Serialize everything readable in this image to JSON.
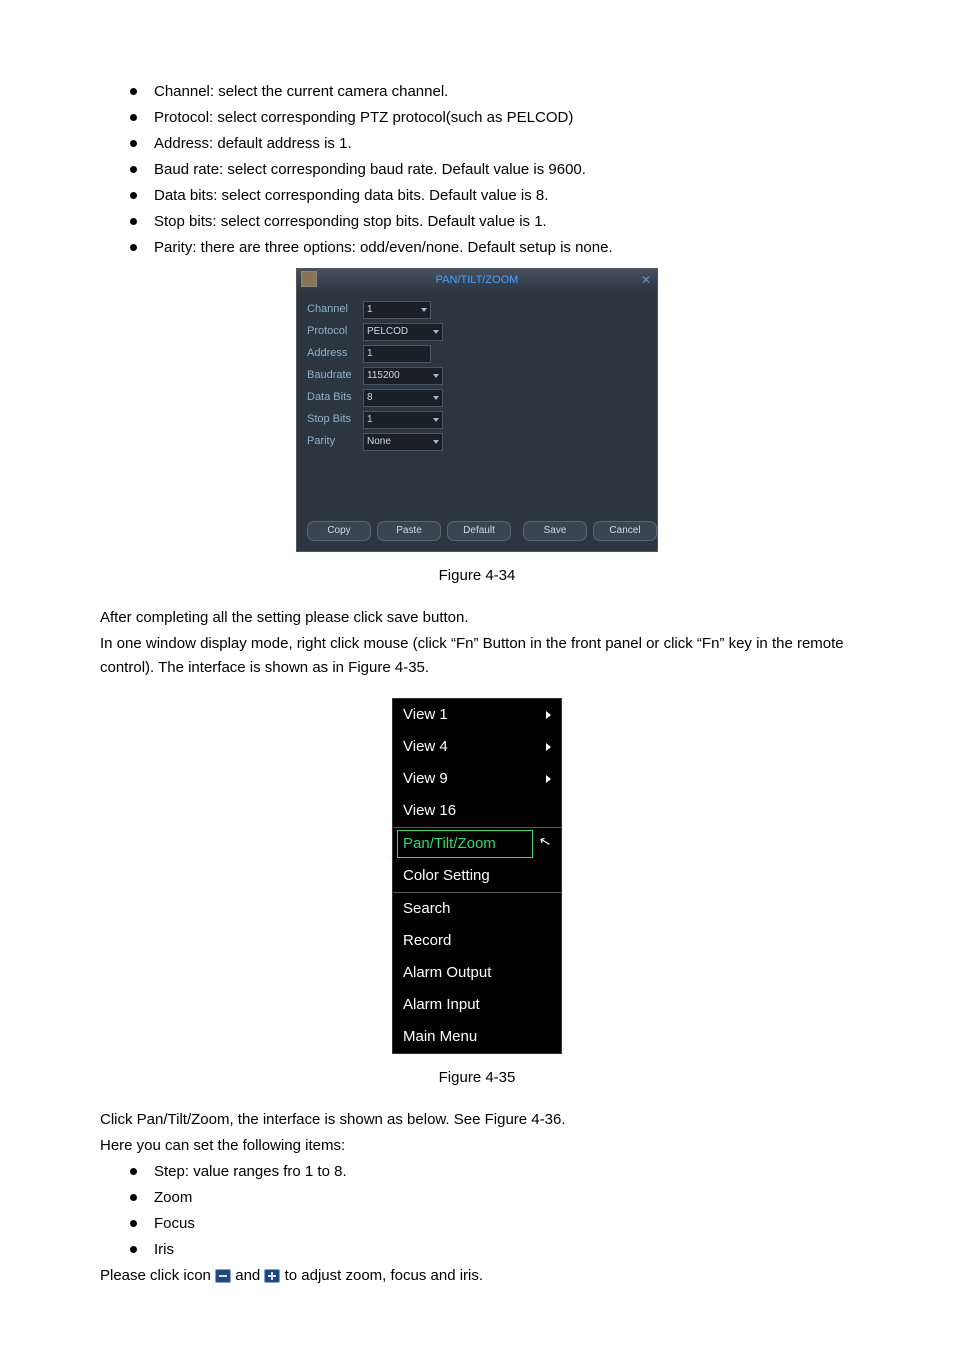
{
  "bullets_top": [
    "Channel: select the current camera channel.",
    "Protocol: select corresponding PTZ protocol(such as PELCOD)",
    "Address: default address is 1.",
    "Baud rate: select corresponding baud rate. Default value is 9600.",
    "Data bits: select corresponding data bits. Default value is 8.",
    "Stop bits: select corresponding stop bits. Default value is 1.",
    "Parity: there are three options: odd/even/none. Default setup is none."
  ],
  "ptz": {
    "title": "PAN/TILT/ZOOM",
    "rows": {
      "channel_label": "Channel",
      "channel_value": "1",
      "protocol_label": "Protocol",
      "protocol_value": "PELCOD",
      "address_label": "Address",
      "address_value": "1",
      "baudrate_label": "Baudrate",
      "baudrate_value": "115200",
      "databits_label": "Data Bits",
      "databits_value": "8",
      "stopbits_label": "Stop Bits",
      "stopbits_value": "1",
      "parity_label": "Parity",
      "parity_value": "None"
    },
    "buttons": {
      "copy": "Copy",
      "paste": "Paste",
      "default": "Default",
      "save": "Save",
      "cancel": "Cancel"
    }
  },
  "figcap1": "Figure 4-34",
  "para1": "After completing all the setting please click save button.",
  "para2": "In one window display mode, right click mouse (click “Fn” Button in the front panel or click “Fn” key in the remote control). The interface is shown as in Figure 4-35.",
  "ctx": {
    "view1": "View 1",
    "view4": "View 4",
    "view9": "View 9",
    "view16": "View 16",
    "ptz": "Pan/Tilt/Zoom",
    "color": "Color Setting",
    "search": "Search",
    "record": "Record",
    "alarm_out": "Alarm Output",
    "alarm_in": "Alarm Input",
    "main_menu": "Main Menu"
  },
  "figcap2": "Figure 4-35",
  "para3": "Click Pan/Tilt/Zoom, the interface is shown as below. See Figure 4-36.",
  "para4": "Here you can set the following items:",
  "bullets_bottom": [
    "Step: value ranges fro 1 to 8.",
    "Zoom",
    "Focus",
    "Iris"
  ],
  "para5a": "Please click icon ",
  "para5b": " and ",
  "para5c": " to adjust zoom, focus and iris."
}
